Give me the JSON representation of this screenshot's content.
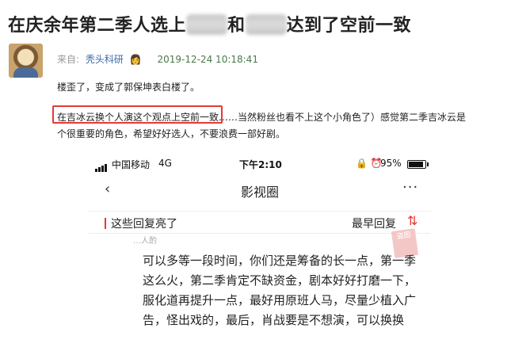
{
  "post": {
    "title_part1": "在庆余年第二季人选上",
    "title_part2": "和",
    "title_part3": "达到了空前一致",
    "meta_from": "来自:",
    "author": "秃头科研",
    "author_emoji": "👩",
    "timestamp": "2019-12-24 10:18:41",
    "paragraph1": "楼歪了，变成了郭保坤表白楼了。",
    "p2_highlight": "在吉冰云换个人演这个观点上空前一致",
    "p2_rest1": "……当然粉丝也看不上这个小角色了）感觉第二季吉冰云是",
    "p2_line2": "个很重要的角色，希望好好选人，不要浪费一部好剧。"
  },
  "screenshot": {
    "status": {
      "carrier": "中国移动",
      "network": "4G",
      "time": "下午2:10",
      "icons": "🔒 ⏰",
      "battery_pct": "95%",
      "battery_level": 0.95
    },
    "nav": {
      "back": "‹",
      "title": "影视圈",
      "more": "···"
    },
    "reply_bar": {
      "left_label": "这些回复亮了",
      "right_label": "最早回复",
      "sort_icon": "⇅"
    },
    "stamp_text": "盗图",
    "user_partial": "…人酌",
    "comment": "可以多等一段时间，你们还是筹备的长一点，第一季这么火，第二季肯定不缺资金，剧本好好打磨一下，服化道再提升一点，最好用原班人马，尽量少植入广告，怪出戏的，最后，肖战要是不想演，可以换换"
  },
  "colors": {
    "highlight_border": "#e53935",
    "author_link": "#3a6aa8",
    "timestamp": "#4a7a4a"
  }
}
